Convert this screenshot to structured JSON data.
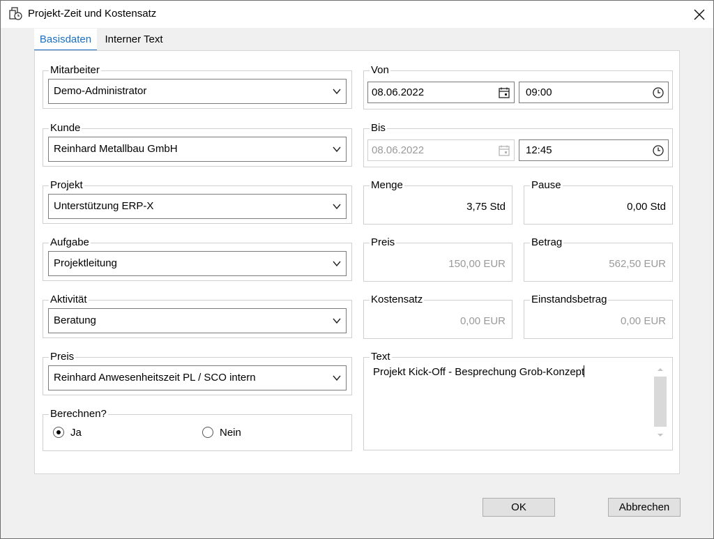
{
  "window": {
    "title": "Projekt-Zeit und Kostensatz",
    "app_icon": "project-time-icon",
    "close_icon": "close-icon"
  },
  "tabs": [
    {
      "label": "Basisdaten",
      "active": true
    },
    {
      "label": "Interner Text",
      "active": false
    }
  ],
  "left": {
    "mitarbeiter": {
      "label": "Mitarbeiter",
      "value": "Demo-Administrator"
    },
    "kunde": {
      "label": "Kunde",
      "value": "Reinhard Metallbau GmbH"
    },
    "projekt": {
      "label": "Projekt",
      "value": "Unterstützung ERP-X"
    },
    "aufgabe": {
      "label": "Aufgabe",
      "value": "Projektleitung"
    },
    "aktivitaet": {
      "label": "Aktivität",
      "value": "Beratung"
    },
    "preis": {
      "label": "Preis",
      "value": "Reinhard Anwesenheitszeit PL / SCO intern"
    },
    "berechnen": {
      "label": "Berechnen?",
      "option_yes": "Ja",
      "option_no": "Nein",
      "selected": "Ja"
    }
  },
  "right": {
    "von": {
      "label": "Von",
      "date": "08.06.2022",
      "time": "09:00"
    },
    "bis": {
      "label": "Bis",
      "date": "08.06.2022",
      "time": "12:45"
    },
    "menge": {
      "label": "Menge",
      "value": "3,75 Std"
    },
    "pause": {
      "label": "Pause",
      "value": "0,00 Std"
    },
    "preis": {
      "label": "Preis",
      "value": "150,00 EUR"
    },
    "betrag": {
      "label": "Betrag",
      "value": "562,50 EUR"
    },
    "kostensatz": {
      "label": "Kostensatz",
      "value": "0,00 EUR"
    },
    "einstandsbetrag": {
      "label": "Einstandsbetrag",
      "value": "0,00 EUR"
    },
    "text": {
      "label": "Text",
      "value": "Projekt Kick-Off - Besprechung Grob-Konzept"
    }
  },
  "buttons": {
    "ok": "OK",
    "cancel": "Abbrechen"
  },
  "colors": {
    "accent": "#1a6fc2",
    "disabled_text": "#9a9a9a"
  }
}
